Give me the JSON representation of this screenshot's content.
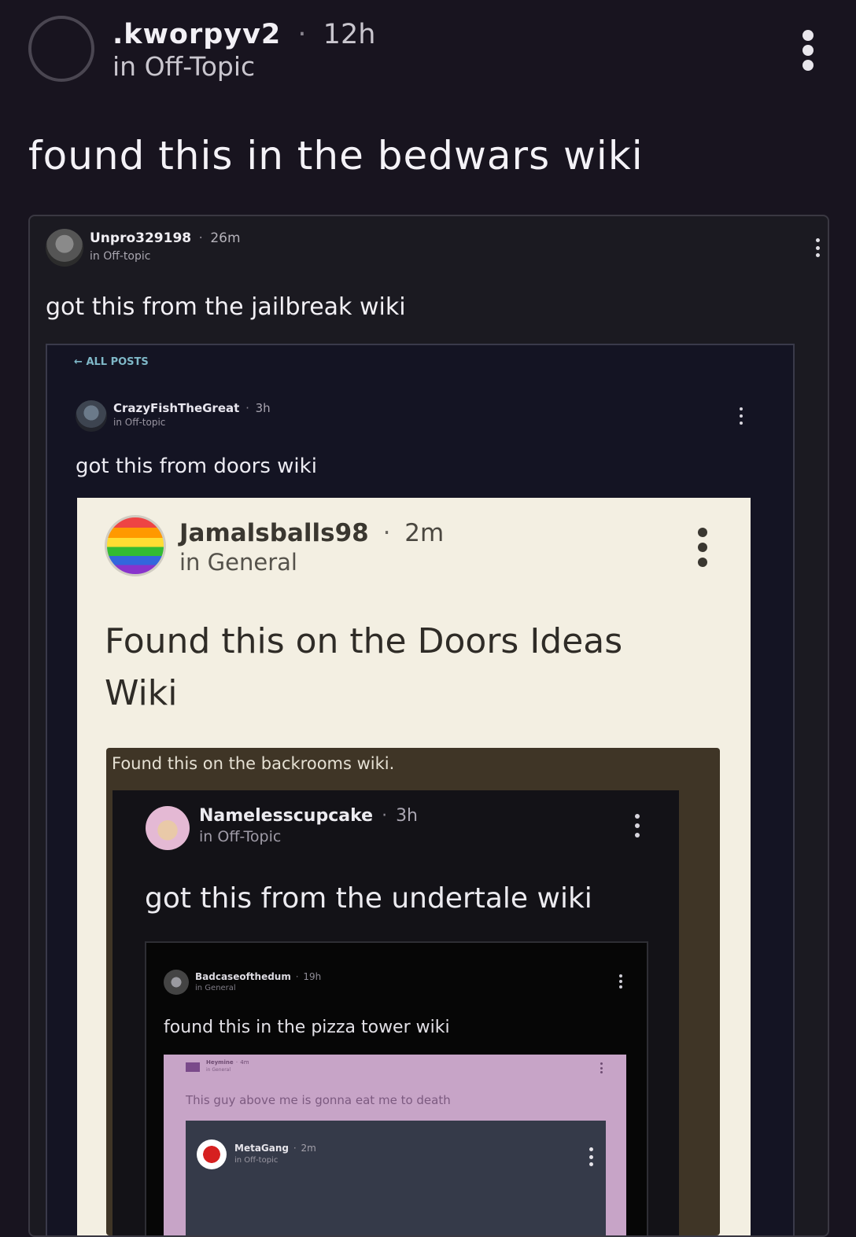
{
  "post": {
    "username": ".kworpyv2",
    "time": "12h",
    "community": "in Off-Topic",
    "title": "found this in the bedwars wiki"
  },
  "level1": {
    "username": "Unpro329198",
    "time": "26m",
    "community": "in Off-topic",
    "title": "got this from the jailbreak wiki"
  },
  "level2": {
    "back_label": "ALL POSTS",
    "username": "CrazyFishTheGreat",
    "time": "3h",
    "community": "in Off-topic",
    "title": "got this from doors wiki"
  },
  "level3": {
    "username": "Jamalsballs98",
    "time": "2m",
    "community": "in General",
    "title_line1": "Found this on the Doors Ideas",
    "title_line2": "Wiki"
  },
  "level4": {
    "caption": "Found this on the backrooms wiki."
  },
  "level5": {
    "username": "Namelesscupcake",
    "time": "3h",
    "community": "in Off-Topic",
    "title": "got this from the undertale wiki"
  },
  "level6": {
    "username": "Badcaseofthedum",
    "time": "19h",
    "community": "in General",
    "title": "found this in the pizza tower wiki"
  },
  "level7": {
    "username": "Heymine",
    "time": "4m",
    "community": "in General",
    "title": "This guy above me is gonna eat me to death"
  },
  "level8": {
    "username": "MetaGang",
    "time": "2m",
    "community": "in Off-topic"
  },
  "icons": {
    "more": "more-vertical-icon",
    "back": "arrow-left-icon"
  },
  "colors": {
    "background": "#18141f",
    "text": "#f2f0f5",
    "muted": "#a9a6b0",
    "cream_card": "#f3efe2",
    "brown_frame": "#3f3526",
    "purple_card": "#c7a4c7"
  }
}
